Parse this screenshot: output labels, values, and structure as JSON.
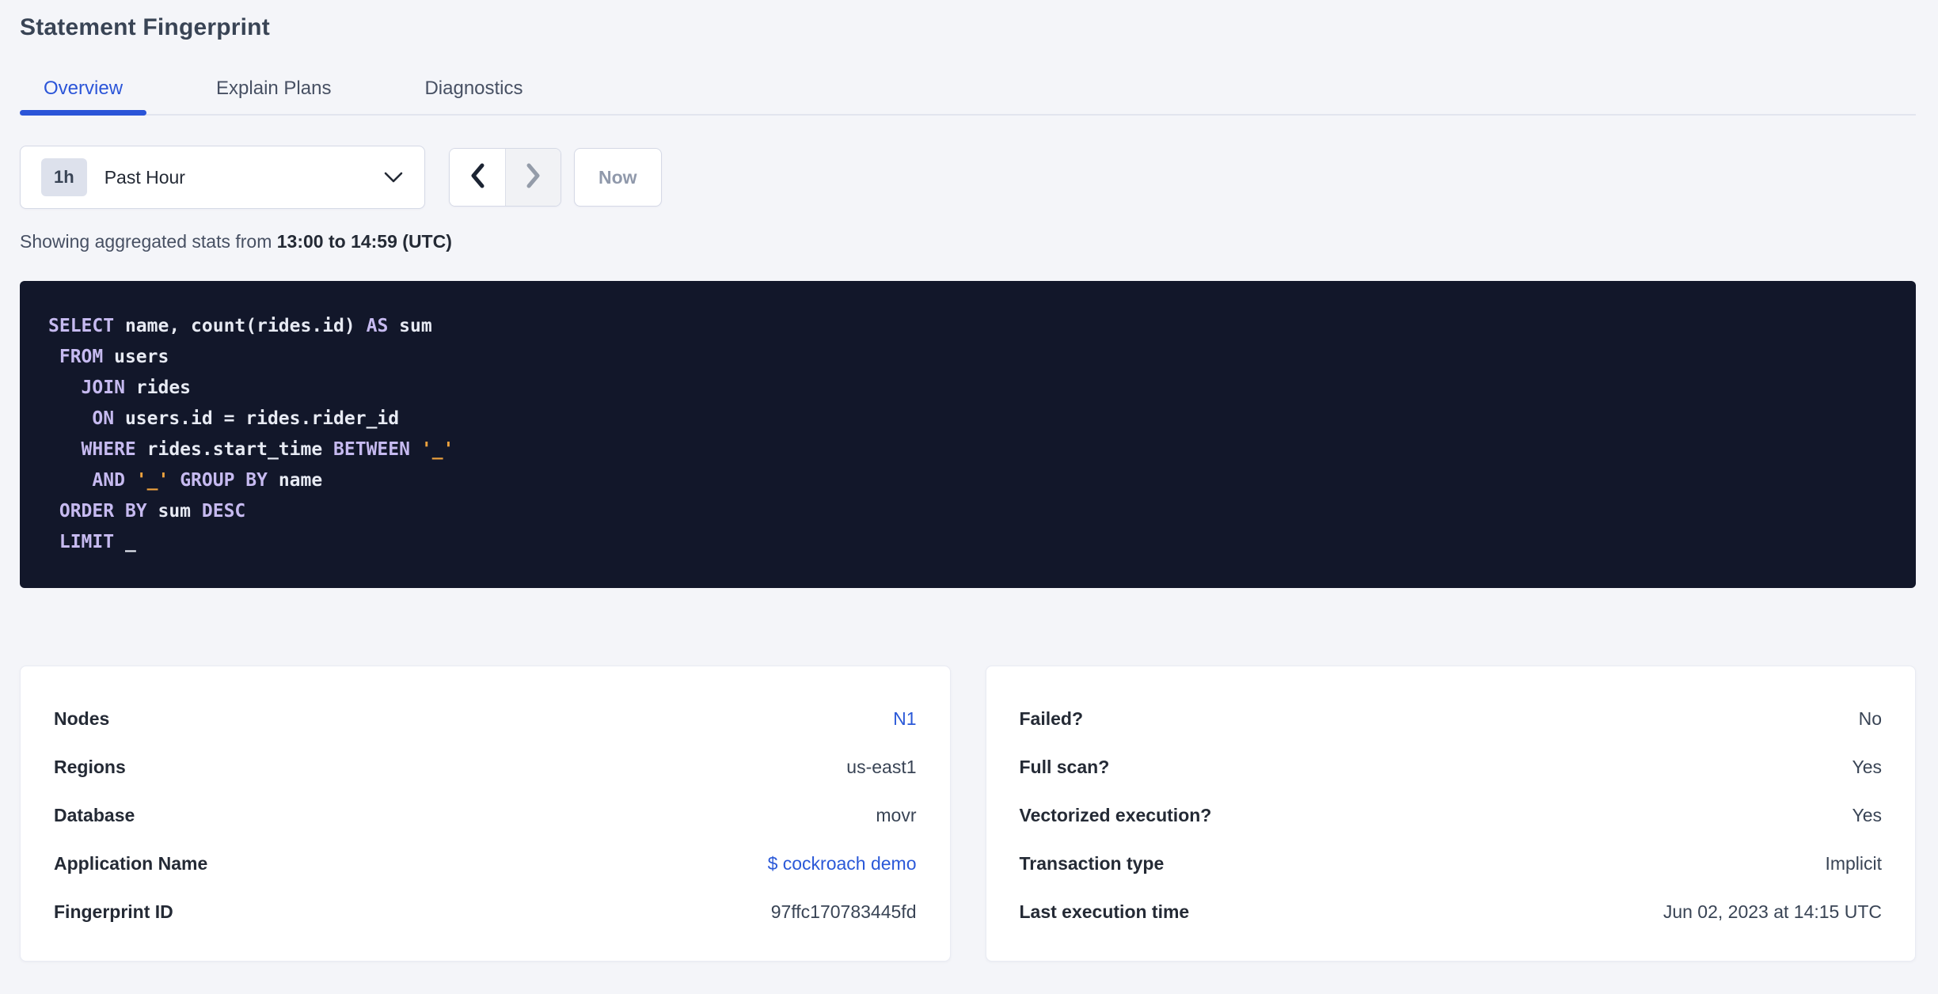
{
  "page": {
    "title": "Statement Fingerprint"
  },
  "tabs": [
    {
      "label": "Overview",
      "active": true
    },
    {
      "label": "Explain Plans",
      "active": false
    },
    {
      "label": "Diagnostics",
      "active": false
    }
  ],
  "time_picker": {
    "badge": "1h",
    "selected": "Past Hour",
    "prev_icon": "chevron-left",
    "next_icon": "chevron-right",
    "now_label": "Now"
  },
  "caption": {
    "prefix": "Showing aggregated stats from ",
    "range": "13:00 to 14:59 (UTC)"
  },
  "sql": {
    "lines": [
      [
        {
          "c": "kw",
          "t": "SELECT"
        },
        {
          "c": "plain",
          "t": " name, count(rides.id) "
        },
        {
          "c": "kw",
          "t": "AS"
        },
        {
          "c": "plain",
          "t": " sum"
        }
      ],
      [
        {
          "c": "plain",
          "t": " "
        },
        {
          "c": "kw",
          "t": "FROM"
        },
        {
          "c": "plain",
          "t": " users"
        }
      ],
      [
        {
          "c": "plain",
          "t": "   "
        },
        {
          "c": "kw",
          "t": "JOIN"
        },
        {
          "c": "plain",
          "t": " rides"
        }
      ],
      [
        {
          "c": "plain",
          "t": "    "
        },
        {
          "c": "kw",
          "t": "ON"
        },
        {
          "c": "plain",
          "t": " users.id = rides.rider_id"
        }
      ],
      [
        {
          "c": "plain",
          "t": "   "
        },
        {
          "c": "kw",
          "t": "WHERE"
        },
        {
          "c": "plain",
          "t": " rides.start_time "
        },
        {
          "c": "kw",
          "t": "BETWEEN"
        },
        {
          "c": "plain",
          "t": " "
        },
        {
          "c": "str",
          "t": "'_'"
        }
      ],
      [
        {
          "c": "plain",
          "t": "    "
        },
        {
          "c": "kw",
          "t": "AND"
        },
        {
          "c": "plain",
          "t": " "
        },
        {
          "c": "str",
          "t": "'_'"
        },
        {
          "c": "plain",
          "t": " "
        },
        {
          "c": "kw",
          "t": "GROUP BY"
        },
        {
          "c": "plain",
          "t": " name"
        }
      ],
      [
        {
          "c": "plain",
          "t": " "
        },
        {
          "c": "kw",
          "t": "ORDER BY"
        },
        {
          "c": "plain",
          "t": " sum "
        },
        {
          "c": "kw",
          "t": "DESC"
        }
      ],
      [
        {
          "c": "plain",
          "t": " "
        },
        {
          "c": "kw",
          "t": "LIMIT"
        },
        {
          "c": "plain",
          "t": " _"
        }
      ]
    ]
  },
  "cards": {
    "left": {
      "rows": [
        {
          "label": "Nodes",
          "value": "N1",
          "link": true
        },
        {
          "label": "Regions",
          "value": "us-east1",
          "link": false
        },
        {
          "label": "Database",
          "value": "movr",
          "link": false
        },
        {
          "label": "Application Name",
          "value": "$ cockroach demo",
          "link": true
        },
        {
          "label": "Fingerprint ID",
          "value": "97ffc170783445fd",
          "link": false
        }
      ]
    },
    "right": {
      "rows": [
        {
          "label": "Failed?",
          "value": "No",
          "link": false
        },
        {
          "label": "Full scan?",
          "value": "Yes",
          "link": false
        },
        {
          "label": "Vectorized execution?",
          "value": "Yes",
          "link": false
        },
        {
          "label": "Transaction type",
          "value": "Implicit",
          "link": false
        },
        {
          "label": "Last execution time",
          "value": "Jun 02, 2023 at 14:15 UTC",
          "link": false
        }
      ]
    }
  },
  "colors": {
    "accent_blue": "#2b55d8",
    "link_blue": "#2b59d8",
    "code_background": "#12172a",
    "code_keyword": "#c6baf0",
    "code_plain": "#e7eaf3",
    "code_string": "#eea23e",
    "page_background": "#f4f5f9"
  }
}
